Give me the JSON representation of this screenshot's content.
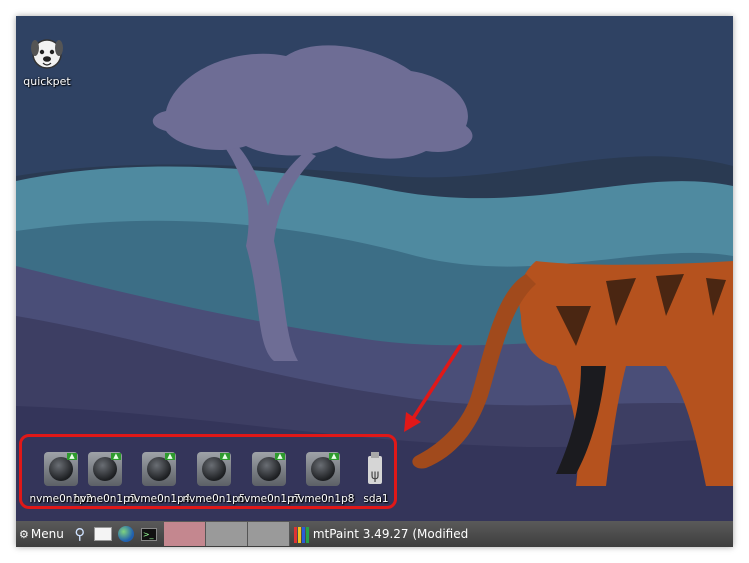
{
  "desktop": {
    "icons": [
      {
        "label": "quickpet",
        "icon": "dog-icon"
      }
    ],
    "drives": [
      {
        "label": "nvme0n1p2",
        "icon": "drive-icon"
      },
      {
        "label": "nvme0n1p3",
        "icon": "drive-icon"
      },
      {
        "label": "nvme0n1p4",
        "icon": "drive-icon"
      },
      {
        "label": "nvme0n1p5",
        "icon": "drive-icon"
      },
      {
        "label": "nvme0n1p7",
        "icon": "drive-icon"
      },
      {
        "label": "nvme0n1p8",
        "icon": "drive-icon"
      }
    ],
    "usb": {
      "label": "sda1",
      "icon": "usb-icon"
    }
  },
  "taskbar": {
    "menu_label": "Menu",
    "launchers": [
      "search-icon",
      "window-icon",
      "globe-icon",
      "terminal-icon"
    ],
    "workspaces": [
      {
        "active": true,
        "color": "#c4878f"
      },
      {
        "active": false,
        "color": "#9a9a9a"
      },
      {
        "active": false,
        "color": "#9a9a9a"
      }
    ],
    "task_title": "mtPaint 3.49.27 (Modified"
  },
  "annotation": {
    "color": "#e01818"
  }
}
